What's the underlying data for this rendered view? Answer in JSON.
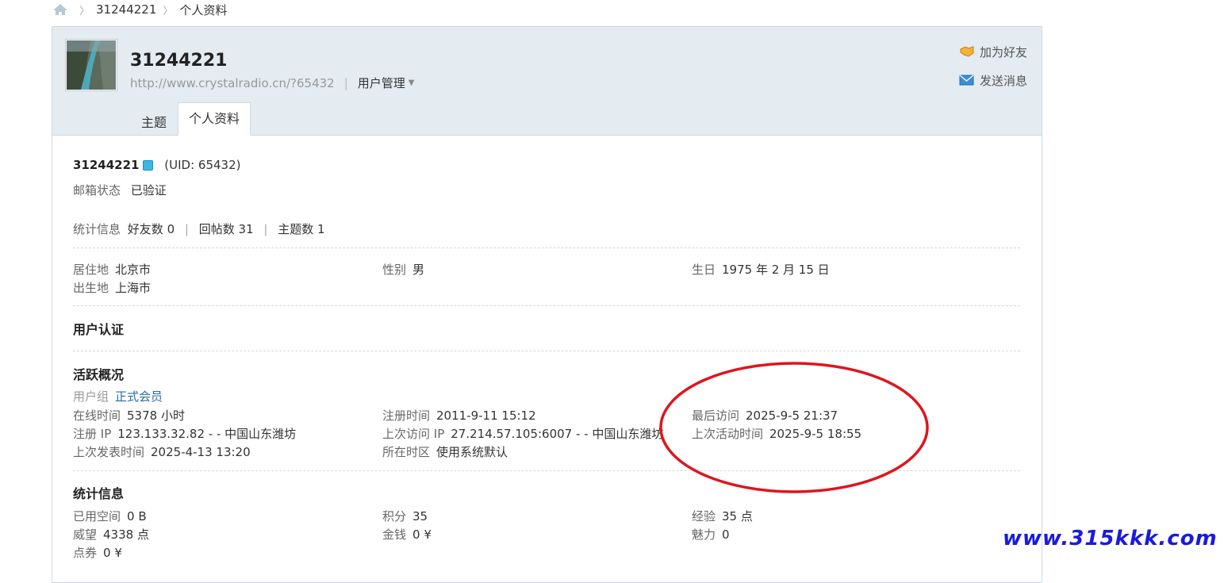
{
  "breadcrumb": {
    "home_icon": "home-icon",
    "uid": "31244221",
    "page": "个人资料"
  },
  "profile": {
    "username": "31244221",
    "website": "http://www.crystalradio.cn/?65432",
    "user_manage": "用户管理",
    "add_friend": "加为好友",
    "send_message": "发送消息",
    "tabs": [
      "主题",
      "个人资料"
    ]
  },
  "summary": {
    "username": "31244221",
    "uid": "(UID: 65432)",
    "email_label": "邮箱状态",
    "email_value": "已验证",
    "stats_label": "统计信息",
    "friends": "好友数 0",
    "replies": "回帖数 31",
    "threads": "主题数 1"
  },
  "basic": {
    "residence_label": "居住地",
    "residence": "北京市",
    "gender_label": "性别",
    "gender": "男",
    "birthday_label": "生日",
    "birthday": "1975 年 2 月 15 日",
    "birthplace_label": "出生地",
    "birthplace": "上海市"
  },
  "auth_title": "用户认证",
  "activity": {
    "title": "活跃概况",
    "group_label": "用户组",
    "group": "正式会员",
    "online_label": "在线时间",
    "online": "5378 小时",
    "reg_time_label": "注册时间",
    "reg_time": "2011-9-11 15:12",
    "last_visit_label": "最后访问",
    "last_visit": "2025-9-5 21:37",
    "reg_ip_label": "注册 IP",
    "reg_ip": "123.133.32.82 - - 中国山东潍坊",
    "last_ip_label": "上次访问 IP",
    "last_ip": "27.214.57.105:6007 - - 中国山东潍坊",
    "last_active_label": "上次活动时间",
    "last_active": "2025-9-5 18:55",
    "last_post_label": "上次发表时间",
    "last_post": "2025-4-13 13:20",
    "tz_label": "所在时区",
    "tz": "使用系统默认"
  },
  "stats": {
    "title": "统计信息",
    "space_label": "已用空间",
    "space": "0 B",
    "points_label": "积分",
    "points": "35",
    "exp_label": "经验",
    "exp": "35 点",
    "prestige_label": "威望",
    "prestige": "4338 点",
    "money_label": "金钱",
    "money": "0 ¥",
    "charm_label": "魅力",
    "charm": "0",
    "coupon_label": "点券",
    "coupon": "0 ¥"
  },
  "watermark": "www.315kkk.com",
  "colors": {
    "header_bg": "#e4ecf1",
    "link_blue": "#2b6ca3",
    "annotation_red": "#e0141c",
    "watermark_blue": "#1a1ae0"
  }
}
